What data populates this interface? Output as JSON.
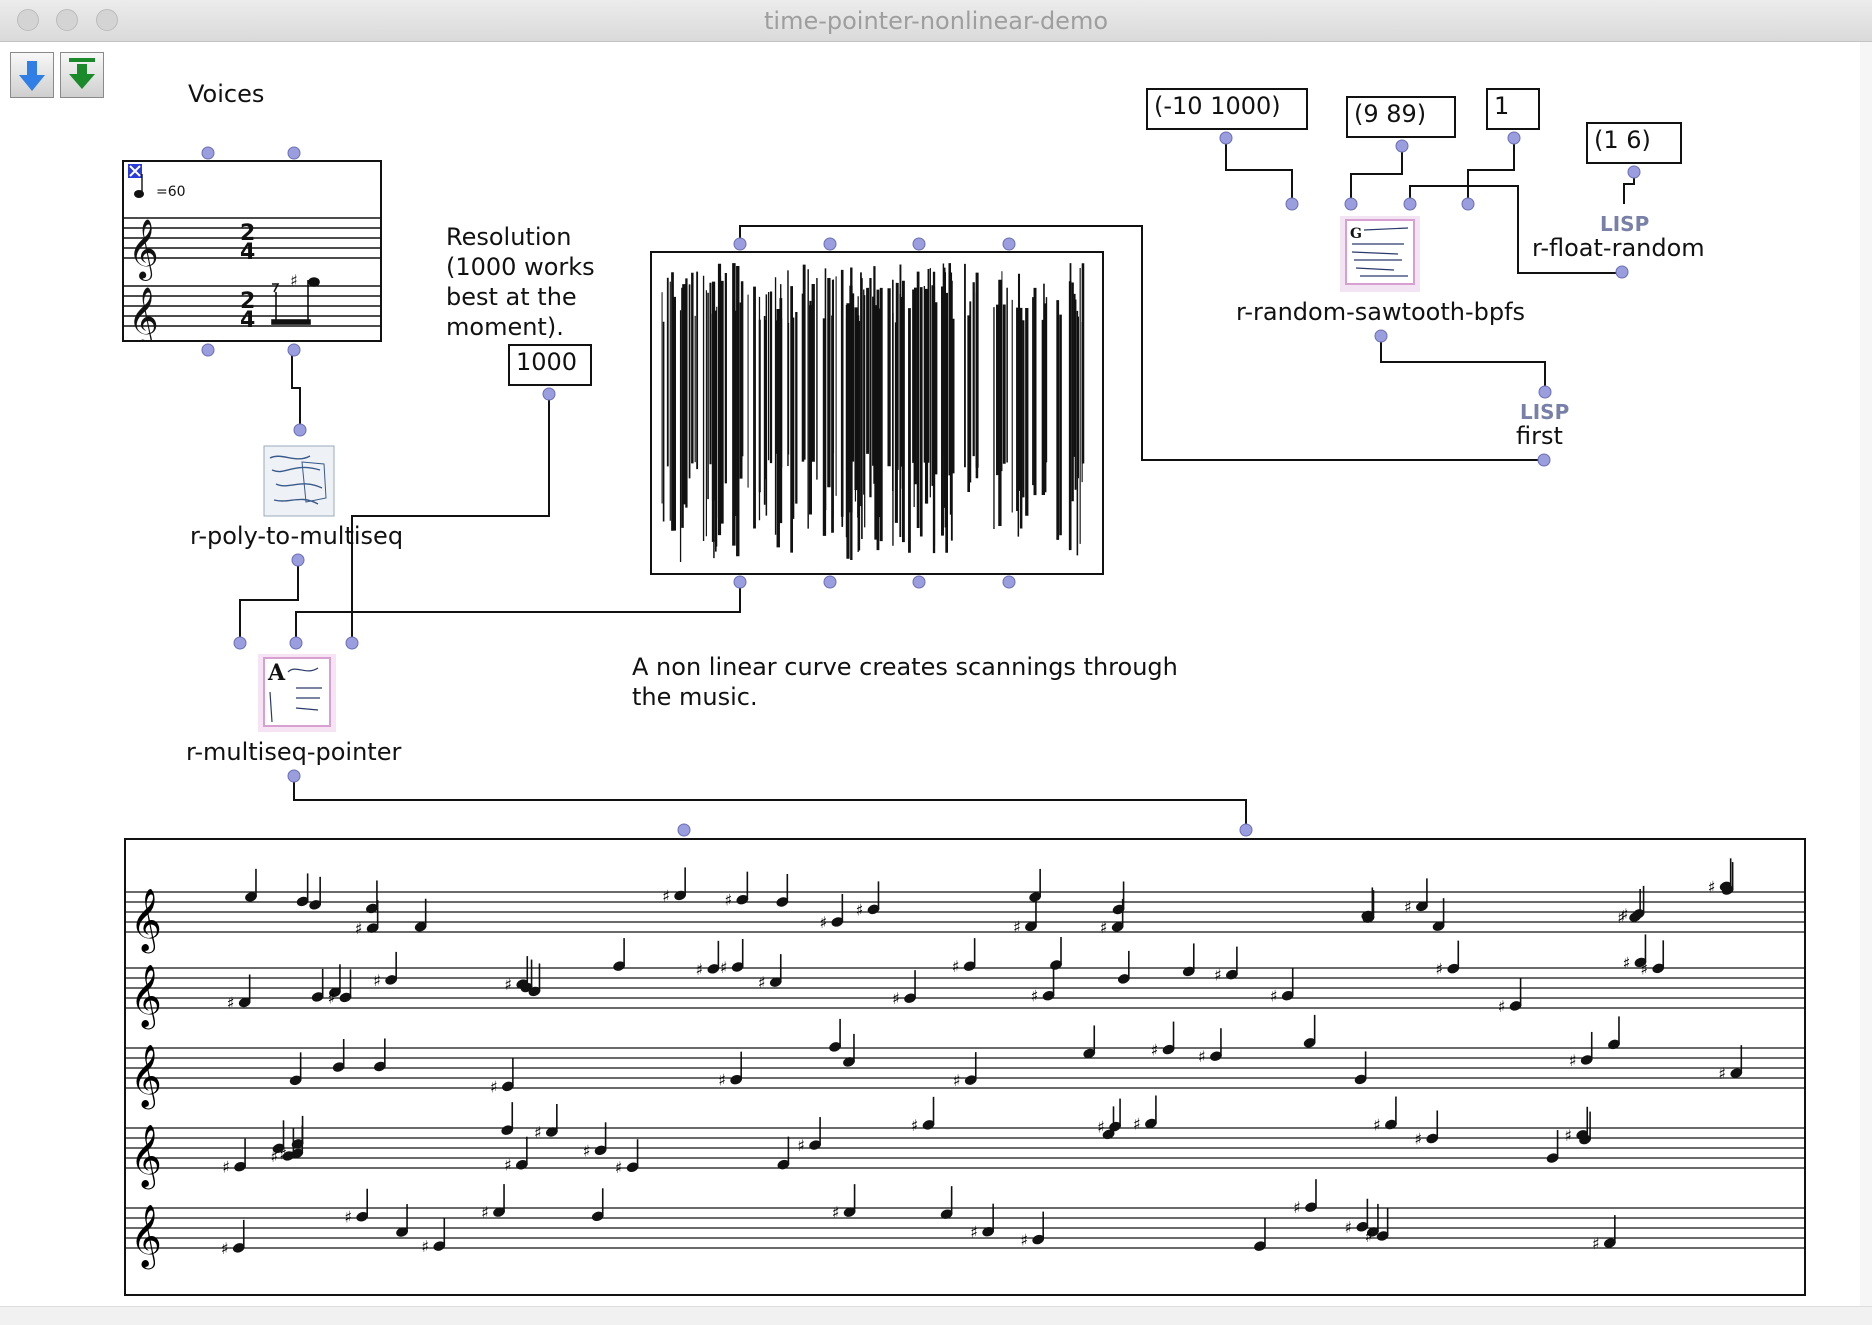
{
  "window": {
    "title": "time-pointer-nonlinear-demo"
  },
  "toolbar": {
    "eval_icon": "blue-down-arrow-icon",
    "eval_all_icon": "green-down-arrow-icon"
  },
  "patch": {
    "voices_label": "Voices",
    "tempo_text": "=60",
    "time_signature": [
      "2",
      "4"
    ],
    "resolution_comment": [
      "Resolution",
      "(1000 works",
      "best at the",
      "moment)."
    ],
    "resolution_value": "1000",
    "comment_nonlinear": [
      "A non linear curve creates scannings through",
      "the music."
    ],
    "box_range": "(-10 1000)",
    "box_points": "(9 89)",
    "box_one": "1",
    "box_float_range": "(1 6)",
    "lisp_label": "LISP",
    "fn_float_random": "r-float-random",
    "fn_sawtooth": "r-random-sawtooth-bpfs",
    "fn_first": "first",
    "fn_poly_to_multiseq": "r-poly-to-multiseq",
    "fn_multiseq_pointer": "r-multiseq-pointer"
  },
  "colors": {
    "inlet": "#9a9ede",
    "wire": "#111111",
    "lisp": "#7880a8"
  }
}
